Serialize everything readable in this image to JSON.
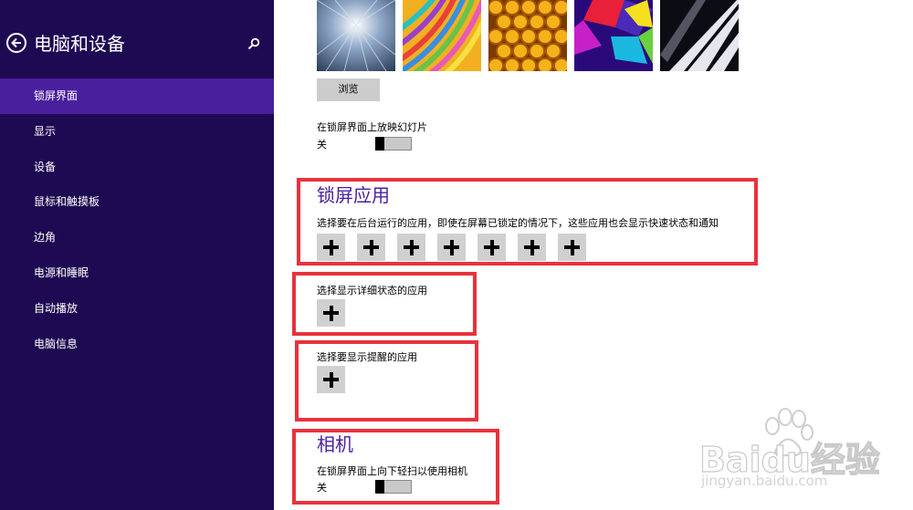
{
  "sidebar": {
    "title": "电脑和设备",
    "back_icon": "back-arrow-icon",
    "search_icon": "search-icon",
    "accent_color": "#1e0a52",
    "active_color": "#4a1f9e",
    "items": [
      {
        "label": "锁屏界面",
        "active": true
      },
      {
        "label": "显示"
      },
      {
        "label": "设备"
      },
      {
        "label": "鼠标和触摸板"
      },
      {
        "label": "边角"
      },
      {
        "label": "电源和睡眠"
      },
      {
        "label": "自动播放"
      },
      {
        "label": "电脑信息"
      }
    ]
  },
  "background": {
    "browse_label": "浏览",
    "slideshow_label": "在锁屏界面上放映幻灯片",
    "slideshow_state": "关"
  },
  "lock_apps": {
    "title": "锁屏应用",
    "description": "选择要在后台运行的应用，即使在屏幕已锁定的情况下，这些应用也会显示快速状态和通知",
    "add_icon": "plus-icon",
    "slot_count": 7
  },
  "detailed_status": {
    "label": "选择显示详细状态的应用"
  },
  "alarm": {
    "label": "选择要显示提醒的应用"
  },
  "camera": {
    "title": "相机",
    "swipe_label": "在锁屏界面上向下轻扫以使用相机",
    "swipe_state": "关"
  },
  "watermark": {
    "brand": "Baidu经验",
    "url": "jingyan.baidu.com"
  },
  "annotation_color": "#e8323c"
}
